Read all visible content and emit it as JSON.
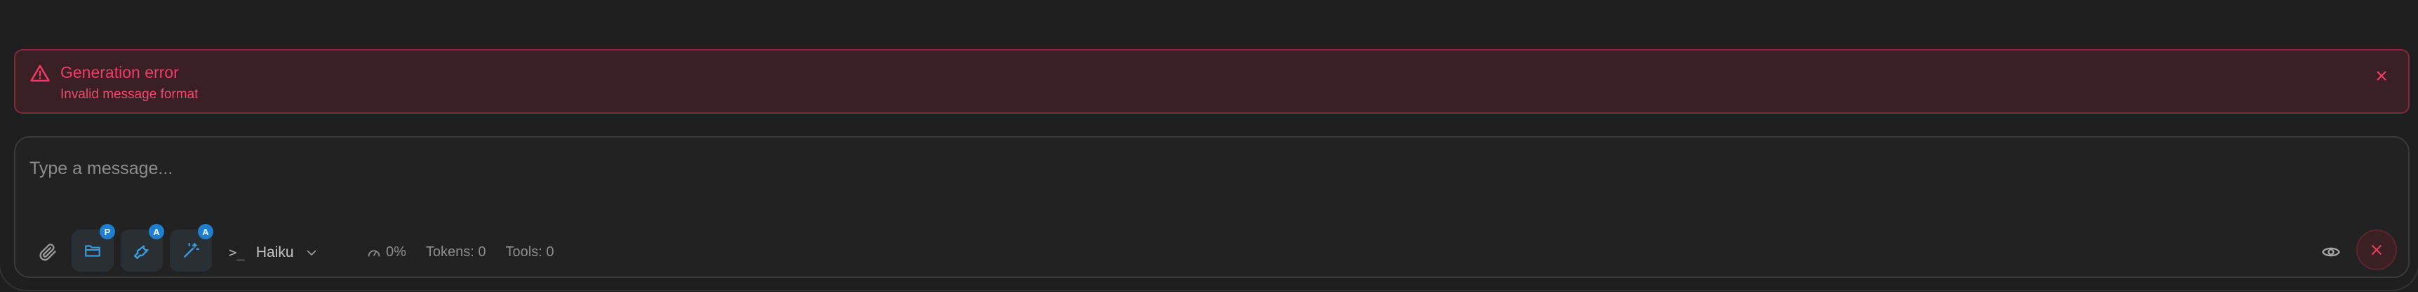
{
  "error": {
    "title": "Generation error",
    "detail": "Invalid message format",
    "icon": "warning-triangle-icon",
    "close_icon": "close-icon",
    "color": "#f03b6a"
  },
  "composer": {
    "placeholder": "Type a message...",
    "value": "",
    "tools": [
      {
        "icon": "folder-icon",
        "badge": "P"
      },
      {
        "icon": "wrench-icon",
        "badge": "A"
      },
      {
        "icon": "magic-wand-icon",
        "badge": "A"
      }
    ],
    "model": {
      "prompt_glyph": ">_",
      "name": "Haiku"
    },
    "stats": {
      "context": "0%",
      "tokens": "Tokens: 0",
      "tools": "Tools: 0"
    },
    "accent": "#1e7fd0"
  }
}
